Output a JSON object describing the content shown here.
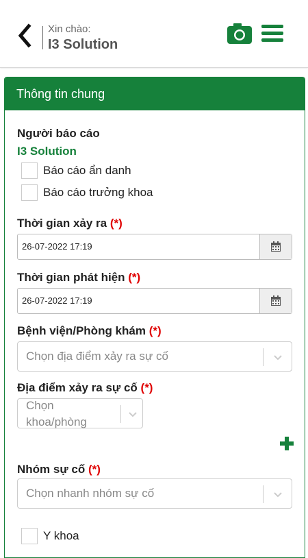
{
  "header": {
    "greeting": "Xin chào:",
    "user": "I3 Solution"
  },
  "panel": {
    "title": "Thông tin chung",
    "reporter_label": "Người báo cáo",
    "reporter_name": "I3 Solution",
    "checkboxes": [
      {
        "label": "Báo cáo ẩn danh",
        "checked": false
      },
      {
        "label": "Báo cáo trưởng khoa",
        "checked": false
      }
    ],
    "required_mark": "(*)",
    "occurred_time": {
      "label": "Thời gian xảy ra",
      "value": "26-07-2022 17:19"
    },
    "detected_time": {
      "label": "Thời gian phát hiện",
      "value": "26-07-2022 17:19"
    },
    "hospital": {
      "label": "Bệnh viện/Phòng khám",
      "placeholder": "Chọn địa điểm xảy ra sự cố"
    },
    "location": {
      "label": "Địa điểm xảy ra sự cố",
      "placeholder_line1": "Chọn",
      "placeholder_line2": "khoa/phòng"
    },
    "incident_group": {
      "label": "Nhóm sự cố",
      "placeholder": "Chọn nhanh nhóm sự cố"
    },
    "group_options": [
      {
        "label": "Y khoa",
        "checked": false
      }
    ]
  },
  "colors": {
    "brand_green": "#16813b",
    "required_red": "#e00000"
  },
  "icons": {
    "back": "chevron-left-icon",
    "camera": "camera-icon",
    "menu": "hamburger-menu-icon",
    "calendar": "calendar-icon",
    "add": "plus-icon",
    "dropdown": "chevron-down-icon"
  }
}
